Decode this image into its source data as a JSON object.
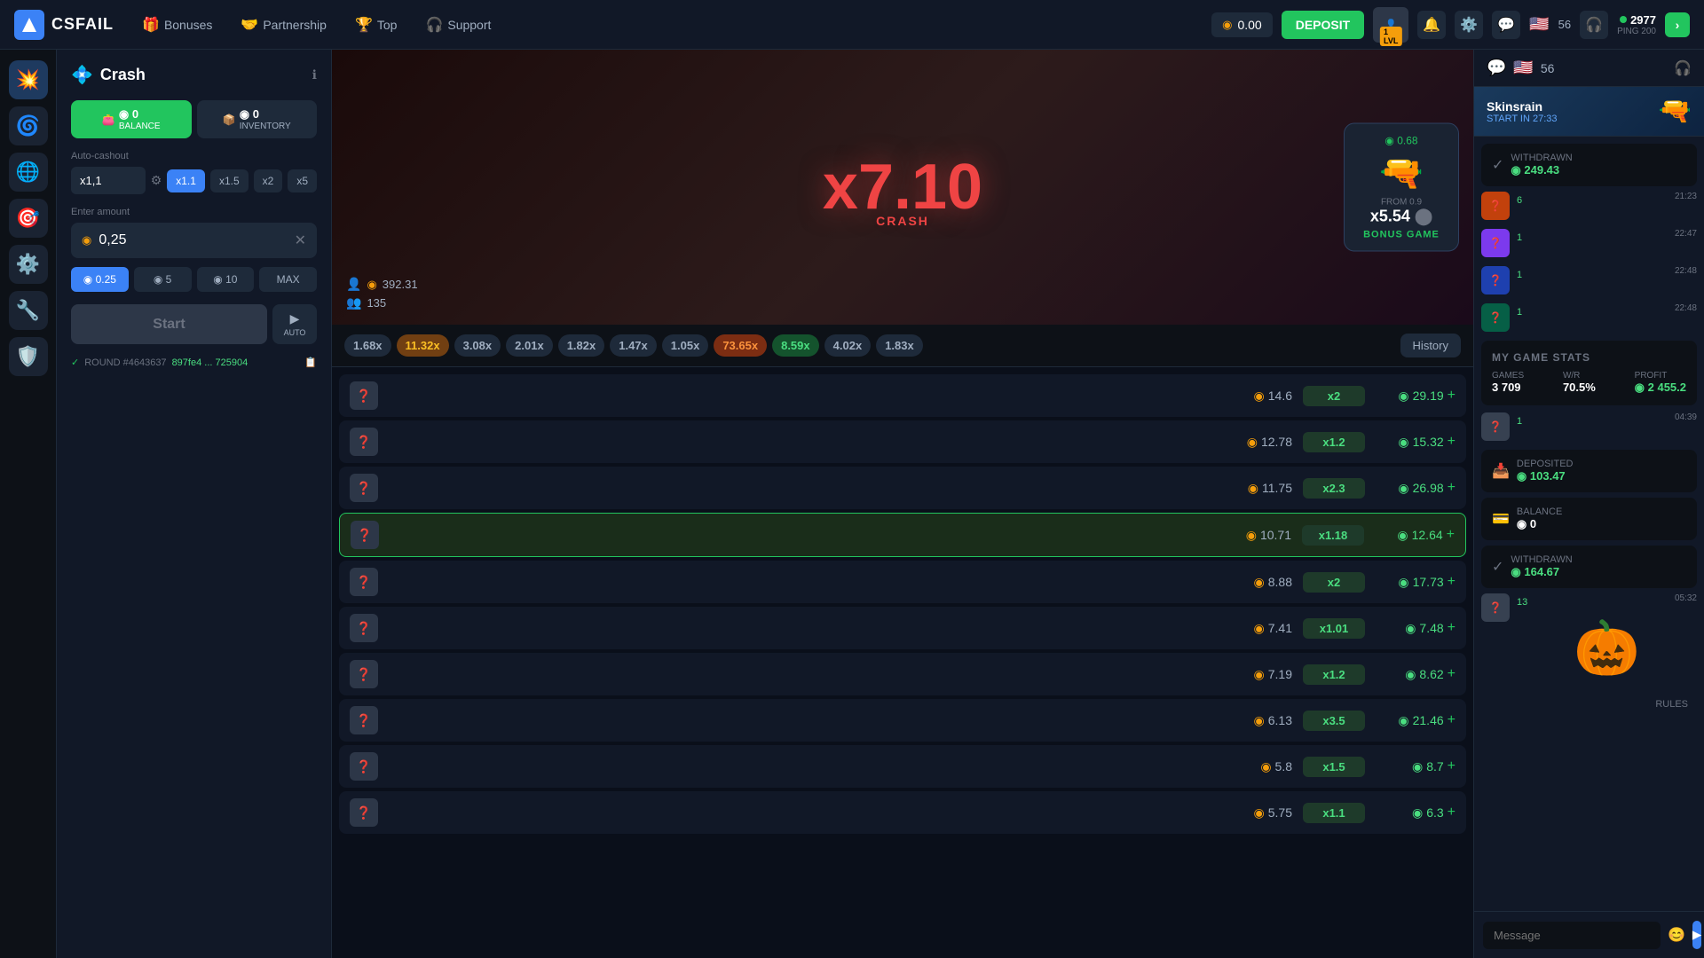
{
  "topnav": {
    "logo": "CSFAIL",
    "nav_items": [
      {
        "id": "bonuses",
        "label": "Bonuses",
        "icon": "🎁"
      },
      {
        "id": "partnership",
        "label": "Partnership",
        "icon": "🤝"
      },
      {
        "id": "top",
        "label": "Top",
        "icon": "🏆"
      },
      {
        "id": "support",
        "label": "Support",
        "icon": "🎧"
      }
    ],
    "balance": "0.00",
    "deposit_label": "DEPOSIT",
    "level": "1 LVL",
    "ping": "2977",
    "ping_label": "PING 200",
    "player_count": "56"
  },
  "crash_panel": {
    "title": "Crash",
    "tab_balance": "0 BALANCE",
    "tab_inventory": "0 INVENTORY",
    "autocashout_label": "Auto-cashout",
    "multipliers": [
      "x1,1",
      "x1.1",
      "x1.5",
      "x2",
      "x5"
    ],
    "active_multiplier": "x1.1",
    "enter_amount_label": "Enter amount",
    "amount_value": "0,25",
    "quick_amounts": [
      "0.25",
      "5",
      "10",
      "MAX"
    ],
    "start_label": "Start",
    "auto_label": "AUTO",
    "round_label": "ROUND #4643637",
    "round_hash": "897fe4 ... 725904"
  },
  "crash_game": {
    "multiplier": "x7.10",
    "crash_label": "CRASH",
    "balance": "392.31",
    "players": "135",
    "bonus_price": "0.68",
    "bonus_from": "FROM 0.9",
    "bonus_mult": "x5.54",
    "bonus_label": "BONUS GAME"
  },
  "mult_history": [
    {
      "val": "1.68x",
      "type": "default"
    },
    {
      "val": "11.32x",
      "type": "yellow"
    },
    {
      "val": "3.08x",
      "type": "default"
    },
    {
      "val": "2.01x",
      "type": "default"
    },
    {
      "val": "1.82x",
      "type": "default"
    },
    {
      "val": "1.47x",
      "type": "default"
    },
    {
      "val": "1.05x",
      "type": "default"
    },
    {
      "val": "73.65x",
      "type": "orange"
    },
    {
      "val": "8.59x",
      "type": "green"
    },
    {
      "val": "4.02x",
      "type": "default"
    },
    {
      "val": "1.83x",
      "type": "default"
    }
  ],
  "history_btn": "History",
  "players_table": [
    {
      "bet": "14.6",
      "mult": "x2",
      "profit": "29.19",
      "highlighted": false
    },
    {
      "bet": "12.78",
      "mult": "x1.2",
      "profit": "15.32",
      "highlighted": false
    },
    {
      "bet": "11.75",
      "mult": "x2.3",
      "profit": "26.98",
      "highlighted": false
    },
    {
      "bet": "10.71",
      "mult": "x1.18",
      "profit": "12.64",
      "highlighted": true
    },
    {
      "bet": "8.88",
      "mult": "x2",
      "profit": "17.73",
      "highlighted": false
    },
    {
      "bet": "7.41",
      "mult": "x1.01",
      "profit": "7.48",
      "highlighted": false
    },
    {
      "bet": "7.19",
      "mult": "x1.2",
      "profit": "8.62",
      "highlighted": false
    },
    {
      "bet": "6.13",
      "mult": "x3.5",
      "profit": "21.46",
      "highlighted": false
    },
    {
      "bet": "5.8",
      "mult": "x1.5",
      "profit": "8.7",
      "highlighted": false
    },
    {
      "bet": "5.75",
      "mult": "x1.1",
      "profit": "6.3",
      "highlighted": false
    }
  ],
  "right_sidebar": {
    "skin_name": "Skinsrain",
    "skin_start": "START IN 27:33",
    "withdrawn_1": "249.43",
    "withdrawn_2": "164.67",
    "deposited": "103.47",
    "balance_rs": "0",
    "stats": {
      "title": "MY GAME STATS",
      "games": "3 709",
      "wr": "70.5%",
      "profit": "2 455.2"
    },
    "chat_messages": [
      {
        "num": "6",
        "time": "21:23"
      },
      {
        "num": "1",
        "time": "22:47"
      },
      {
        "num": "1",
        "time": "22:48"
      },
      {
        "num": "1",
        "time": "22:48"
      },
      {
        "num": "1",
        "time": "04:39"
      },
      {
        "num": "13",
        "time": "05:32"
      }
    ],
    "msg_placeholder": "Message",
    "rules_label": "RULES"
  }
}
